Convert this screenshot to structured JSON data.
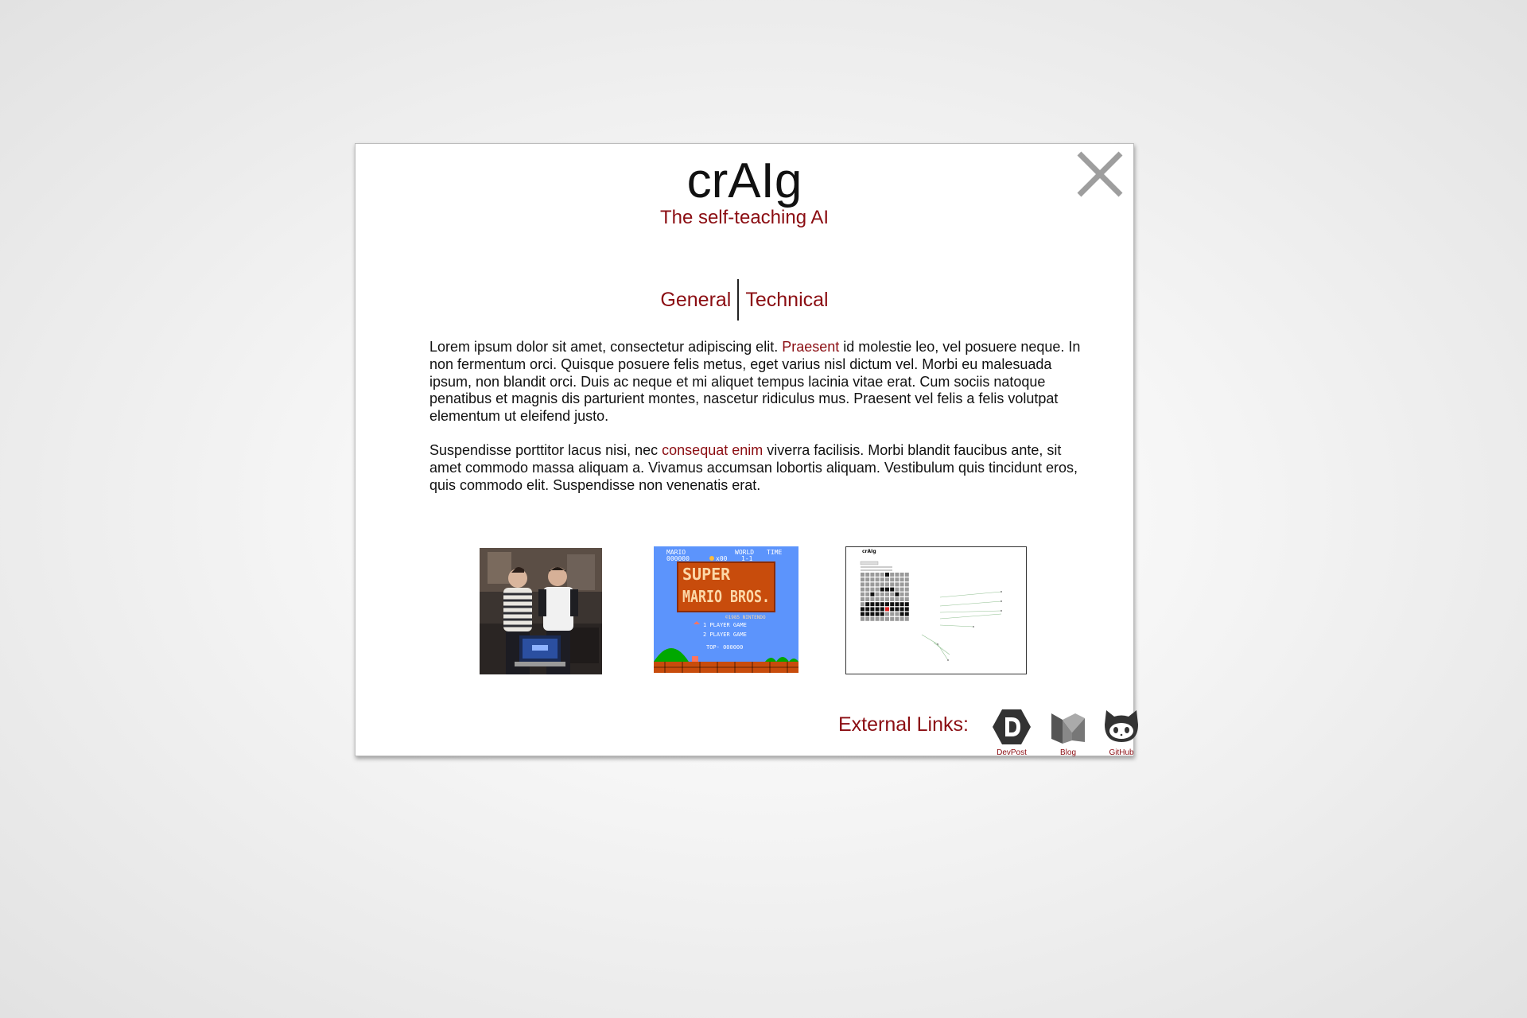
{
  "modal": {
    "title": "crAIg",
    "subtitle": "The self-teaching AI",
    "close_icon": "close-icon",
    "tabs": [
      {
        "label": "General"
      },
      {
        "label": "Technical"
      }
    ],
    "paragraphs": [
      {
        "before": "Lorem ipsum dolor sit amet, consectetur adipiscing elit. ",
        "link": "Praesent",
        "after": " id molestie leo, vel posuere neque. In non fermentum orci. Quisque posuere felis metus, eget varius nisl dictum vel. Morbi eu malesuada ipsum, non blandit orci. Duis ac neque et mi aliquet tempus lacinia vitae erat. Cum sociis natoque penatibus et magnis dis parturient montes, nascetur ridiculus mus. Praesent vel felis a felis volutpat elementum ut eleifend justo."
      },
      {
        "before": "Suspendisse porttitor lacus nisi, nec ",
        "link": "consequat enim",
        "after": " viverra facilisis. Morbi blandit faucibus ante, sit amet commodo massa aliquam a. Vivamus accumsan lobortis aliquam. Vestibulum quis tincidunt eros, quis commodo elit. Suspendisse non venenatis erat."
      }
    ],
    "gallery": {
      "mario": {
        "mario_label": "MARIO",
        "score": "000000",
        "coins": "x00",
        "world_label": "WORLD",
        "world": "1-1",
        "time_label": "TIME",
        "title_line1": "SUPER",
        "title_line2": "MARIO BROS.",
        "copyright": "©1985 NINTENDO",
        "menu1": "1 PLAYER GAME",
        "menu2": "2 PLAYER GAME",
        "top": "TOP- 000000"
      },
      "diagram": {
        "title": "crAIg"
      }
    },
    "external_links": {
      "label": "External Links:",
      "items": [
        {
          "caption": "DevPost",
          "icon": "devpost-icon"
        },
        {
          "caption": "Blog",
          "icon": "medium-icon"
        },
        {
          "caption": "GitHub",
          "icon": "github-icon"
        }
      ]
    },
    "colors": {
      "accent": "#8b0d12",
      "text": "#111111",
      "close_icon": "#9e9e9e"
    }
  }
}
